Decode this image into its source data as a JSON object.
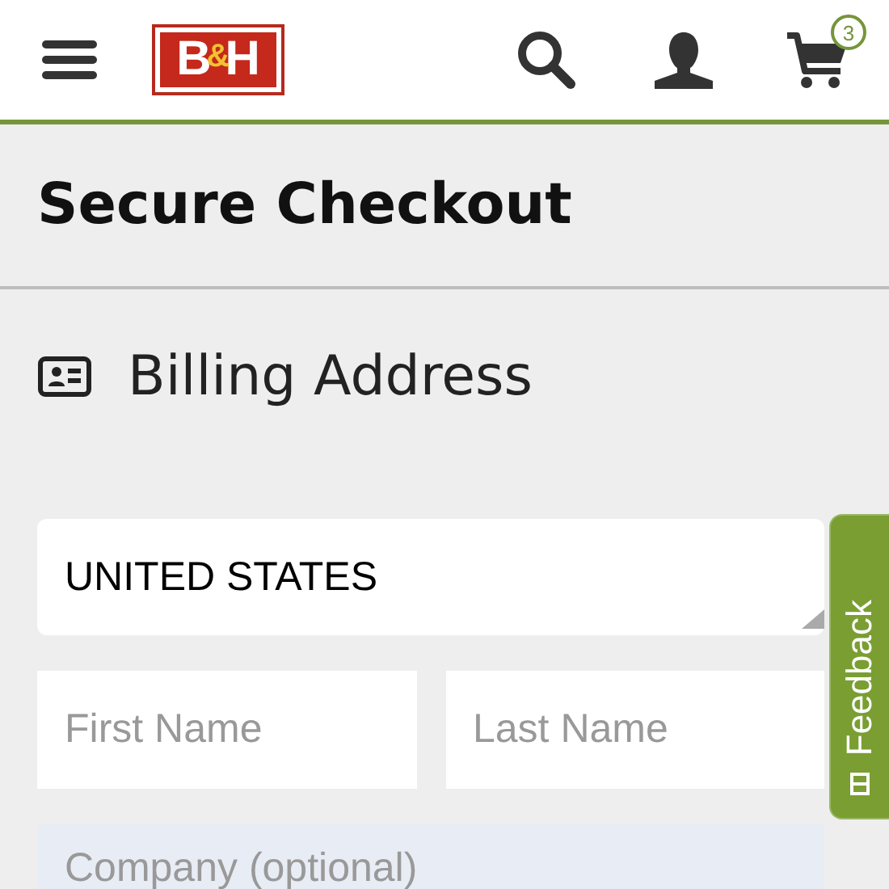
{
  "header": {
    "logo": {
      "left": "B",
      "ampersand": "&",
      "right": "H"
    },
    "cart_count": "3"
  },
  "page_title": "Secure Checkout",
  "section": {
    "title": "Billing Address"
  },
  "form": {
    "country": {
      "value": "UNITED STATES"
    },
    "fields": [
      {
        "placeholder": "First Name",
        "kind": "half"
      },
      {
        "placeholder": "Last Name",
        "kind": "half"
      },
      {
        "placeholder": "Company (optional)",
        "kind": "full"
      }
    ]
  },
  "feedback_tab": {
    "label": "Feedback"
  }
}
